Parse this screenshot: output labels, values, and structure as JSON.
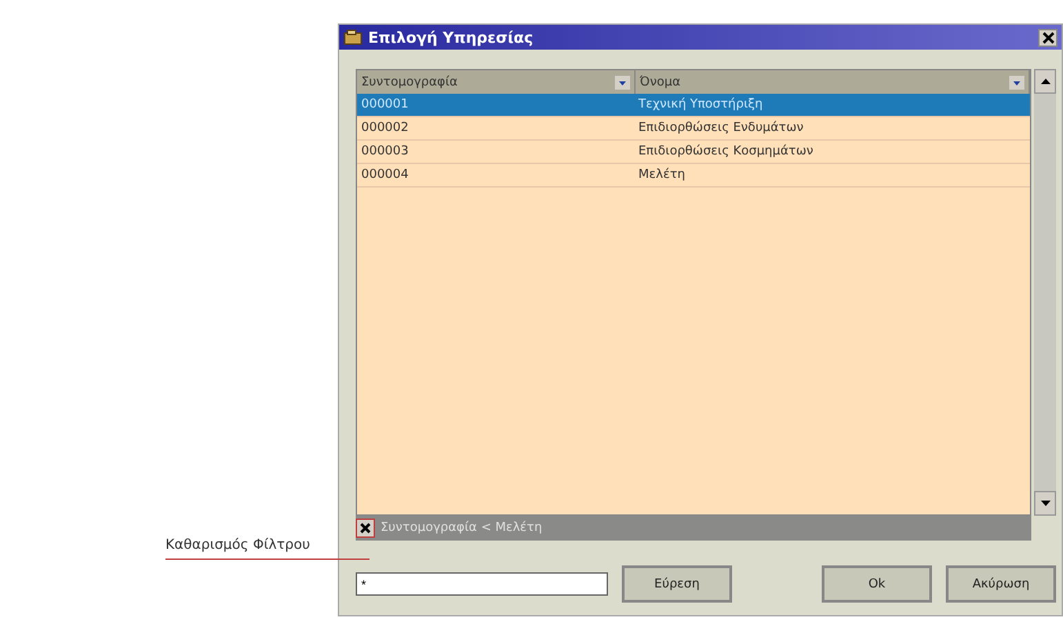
{
  "window": {
    "title": "Επιλογή Υπηρεσίας"
  },
  "table": {
    "columns": [
      "Συντομογραφία",
      "Όνομα"
    ],
    "rows": [
      {
        "cells": [
          "000001",
          "Τεχνική Υποστήριξη"
        ],
        "selected": true
      },
      {
        "cells": [
          "000002",
          "Επιδιορθώσεις Ενδυμάτων"
        ],
        "selected": false
      },
      {
        "cells": [
          "000003",
          "Επιδιορθώσεις Κοσμημάτων"
        ],
        "selected": false
      },
      {
        "cells": [
          "000004",
          "Μελέτη"
        ],
        "selected": false
      }
    ]
  },
  "filter_bar": {
    "text": "Συντομογραφία < Μελέτη"
  },
  "search": {
    "value": "*"
  },
  "buttons": [
    "Εύρεση",
    "Οk",
    "Ακύρωση"
  ],
  "annotation": {
    "label": "Καθαρισμός Φίλτρου"
  }
}
